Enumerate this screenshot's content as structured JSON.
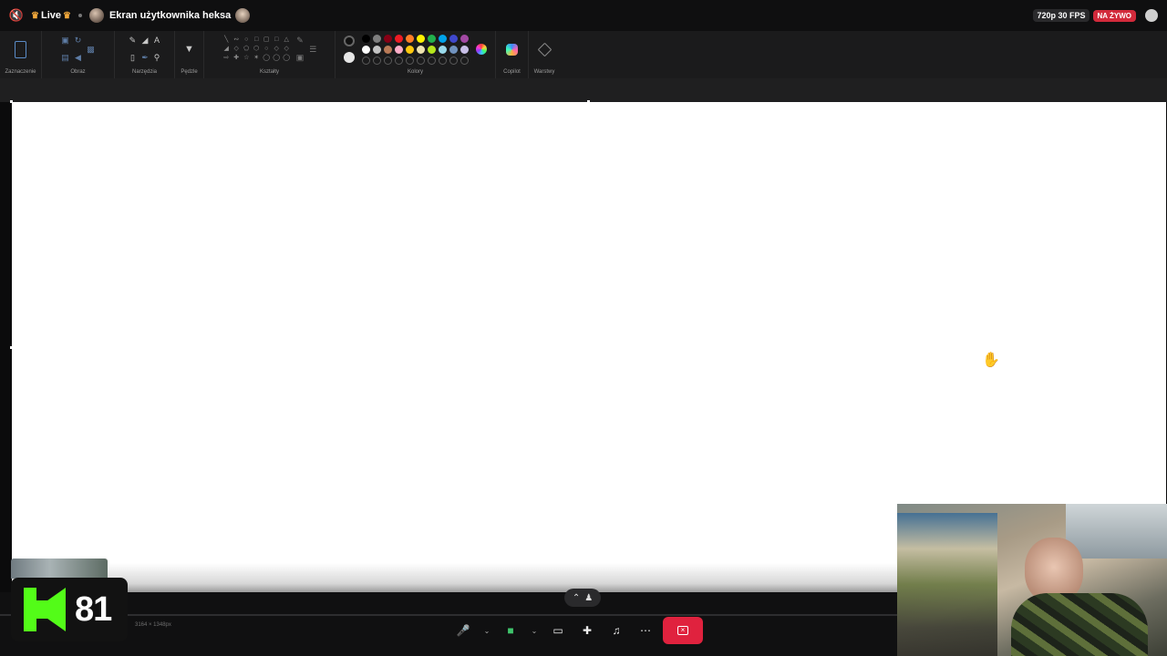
{
  "stream": {
    "live_label": "Live",
    "title": "Ekran użytkownika heksa",
    "quality": "720p 30 FPS",
    "live_badge": "NA ŻYWO"
  },
  "ribbon": {
    "groups": {
      "selection": "Zaznaczenie",
      "image": "Obraz",
      "tools": "Narzędzia",
      "brushes": "Pędzle",
      "shapes": "Kształty",
      "colors": "Kolory",
      "copilot": "Copilot",
      "layers": "Warstwy"
    },
    "colors": {
      "primary": "#111111",
      "secondary": "#e6e6e6",
      "palette_row1": [
        "#000000",
        "#7f7f7f",
        "#880015",
        "#ed1c24",
        "#ff7f27",
        "#fff200",
        "#22b14c",
        "#00a2e8",
        "#3f48cc",
        "#a349a4"
      ],
      "palette_row2": [
        "#ffffff",
        "#c3c3c3",
        "#b97a57",
        "#ffaec9",
        "#ffc90e",
        "#efe4b0",
        "#b5e61d",
        "#99d9ea",
        "#7092be",
        "#c8bfe7"
      ]
    }
  },
  "canvas": {
    "status_text": "3164 × 1348px"
  },
  "kick": {
    "viewer_count": "81",
    "brand_color": "#53fc18"
  },
  "controls": {
    "leave_color": "#e0223e"
  }
}
